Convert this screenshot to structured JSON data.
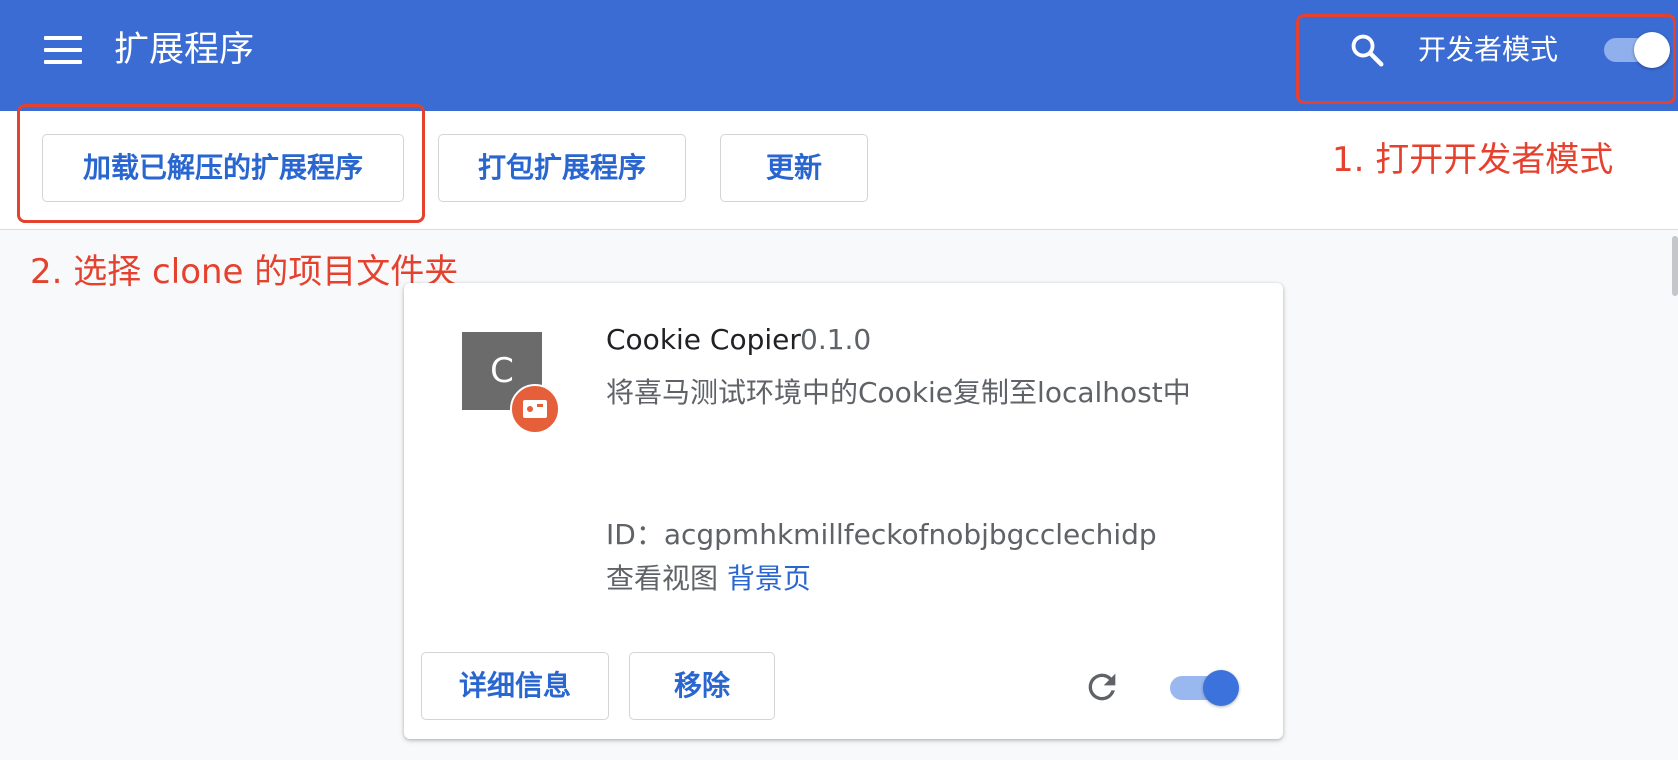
{
  "header": {
    "title": "扩展程序",
    "menu_icon": "hamburger-menu-icon",
    "search_icon": "search-icon",
    "dev_mode_label": "开发者模式",
    "dev_mode_on": true
  },
  "toolbar": {
    "load_unpacked_label": "加载已解压的扩展程序",
    "pack_label": "打包扩展程序",
    "update_label": "更新"
  },
  "annotations": {
    "step1": "1. 打开开发者模式",
    "step2": "2. 选择 clone 的项目文件夹",
    "color": "#e5412f"
  },
  "extension": {
    "icon_letter": "C",
    "name": "Cookie Copier",
    "version": "0.1.0",
    "description": "将喜马测试环境中的Cookie复制至localhost中",
    "id_label": "ID：",
    "id_value": "acgpmhkmillfeckofnobjbgcclechidp",
    "views_label": "查看视图",
    "views_link": "背景页",
    "details_label": "详细信息",
    "remove_label": "移除",
    "reload_icon": "reload-icon",
    "enabled": true
  },
  "colors": {
    "header_bg": "#3b6cd4",
    "accent": "#2a66cf",
    "badge": "#e5603a"
  }
}
